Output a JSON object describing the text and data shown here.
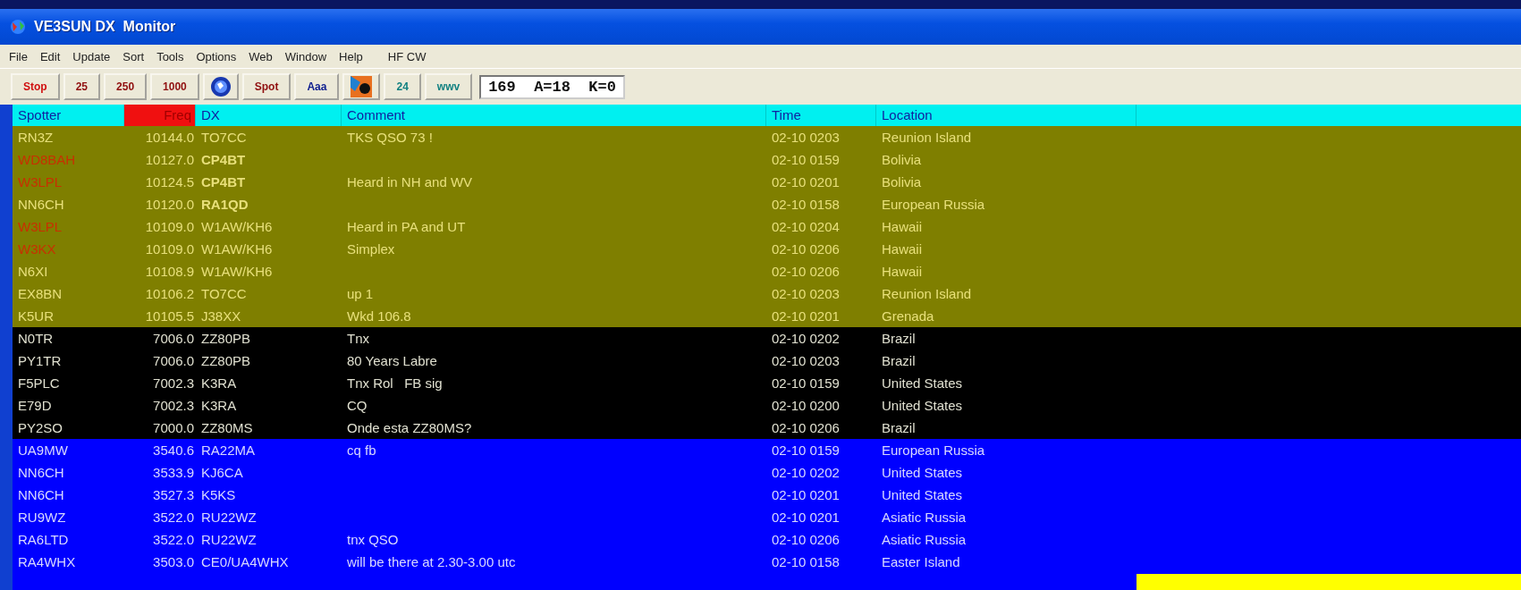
{
  "window": {
    "title": "VE3SUN DX  Monitor"
  },
  "menu": [
    "File",
    "Edit",
    "Update",
    "Sort",
    "Tools",
    "Options",
    "Web",
    "Window",
    "Help",
    "HF CW"
  ],
  "toolbar": [
    {
      "kind": "text",
      "label": "Stop",
      "color": "#d01010"
    },
    {
      "kind": "text",
      "label": "25",
      "color": "#901010"
    },
    {
      "kind": "text",
      "label": "250",
      "color": "#901010"
    },
    {
      "kind": "text",
      "label": "1000",
      "color": "#901010"
    },
    {
      "kind": "icon"
    },
    {
      "kind": "text",
      "label": "Spot",
      "color": "#901010"
    },
    {
      "kind": "text",
      "label": "Aaa",
      "color": "#102090"
    },
    {
      "kind": "icon"
    },
    {
      "kind": "text",
      "label": "24",
      "color": "#108080"
    },
    {
      "kind": "text",
      "label": "wwv",
      "color": "#108080"
    }
  ],
  "status_field": "169  A=18  K=0",
  "table": {
    "columns": [
      {
        "label": "Spotter",
        "selected": false
      },
      {
        "label": "Freq",
        "selected": true
      },
      {
        "label": "DX",
        "selected": false
      },
      {
        "label": "Comment",
        "selected": false
      },
      {
        "label": "Time",
        "selected": false
      },
      {
        "label": "Location",
        "selected": false
      }
    ],
    "groups": [
      {
        "color": "#7f7f00",
        "rows": [
          {
            "spotter": "RN3Z",
            "highlighted": false,
            "freq": "10144.0",
            "dx": "TO7CC",
            "dx_bold": false,
            "comment": "TKS QSO 73 !",
            "time": "02-10 0203",
            "location": "Reunion Island"
          },
          {
            "spotter": "WD8BAH",
            "highlighted": true,
            "freq": "10127.0",
            "dx": "CP4BT",
            "dx_bold": true,
            "comment": "",
            "time": "02-10 0159",
            "location": "Bolivia"
          },
          {
            "spotter": "W3LPL",
            "highlighted": true,
            "freq": "10124.5",
            "dx": "CP4BT",
            "dx_bold": true,
            "comment": "Heard in NH and WV",
            "time": "02-10 0201",
            "location": "Bolivia"
          },
          {
            "spotter": "NN6CH",
            "highlighted": false,
            "freq": "10120.0",
            "dx": "RA1QD",
            "dx_bold": true,
            "comment": "",
            "time": "02-10 0158",
            "location": "European Russia"
          },
          {
            "spotter": "W3LPL",
            "highlighted": true,
            "freq": "10109.0",
            "dx": "W1AW/KH6",
            "dx_bold": false,
            "comment": "Heard in PA and UT",
            "time": "02-10 0204",
            "location": "Hawaii"
          },
          {
            "spotter": "W3KX",
            "highlighted": true,
            "freq": "10109.0",
            "dx": "W1AW/KH6",
            "dx_bold": false,
            "comment": "Simplex",
            "time": "02-10 0206",
            "location": "Hawaii"
          },
          {
            "spotter": "N6XI",
            "highlighted": false,
            "freq": "10108.9",
            "dx": "W1AW/KH6",
            "dx_bold": false,
            "comment": "",
            "time": "02-10 0206",
            "location": "Hawaii"
          },
          {
            "spotter": "EX8BN",
            "highlighted": false,
            "freq": "10106.2",
            "dx": "TO7CC",
            "dx_bold": false,
            "comment": "up 1",
            "time": "02-10 0203",
            "location": "Reunion Island"
          },
          {
            "spotter": "K5UR",
            "highlighted": false,
            "freq": "10105.5",
            "dx": "J38XX",
            "dx_bold": false,
            "comment": "Wkd 106.8",
            "time": "02-10 0201",
            "location": "Grenada"
          }
        ]
      },
      {
        "color": "#000000",
        "rows": [
          {
            "spotter": "N0TR",
            "highlighted": false,
            "freq": "7006.0",
            "dx": "ZZ80PB",
            "dx_bold": false,
            "comment": "Tnx",
            "time": "02-10 0202",
            "location": "Brazil"
          },
          {
            "spotter": "PY1TR",
            "highlighted": false,
            "freq": "7006.0",
            "dx": "ZZ80PB",
            "dx_bold": false,
            "comment": "80 Years Labre",
            "time": "02-10 0203",
            "location": "Brazil"
          },
          {
            "spotter": "F5PLC",
            "highlighted": false,
            "freq": "7002.3",
            "dx": "K3RA",
            "dx_bold": false,
            "comment": "Tnx Rol   FB sig",
            "time": "02-10 0159",
            "location": "United States"
          },
          {
            "spotter": "E79D",
            "highlighted": false,
            "freq": "7002.3",
            "dx": "K3RA",
            "dx_bold": false,
            "comment": "CQ",
            "time": "02-10 0200",
            "location": "United States"
          },
          {
            "spotter": "PY2SO",
            "highlighted": false,
            "freq": "7000.0",
            "dx": "ZZ80MS",
            "dx_bold": false,
            "comment": "Onde esta ZZ80MS?",
            "time": "02-10 0206",
            "location": "Brazil"
          }
        ]
      },
      {
        "color": "#0000ff",
        "rows": [
          {
            "spotter": "UA9MW",
            "highlighted": false,
            "freq": "3540.6",
            "dx": "RA22MA",
            "dx_bold": false,
            "comment": "cq fb",
            "time": "02-10 0159",
            "location": "European Russia"
          },
          {
            "spotter": "NN6CH",
            "highlighted": false,
            "freq": "3533.9",
            "dx": "KJ6CA",
            "dx_bold": false,
            "comment": "",
            "time": "02-10 0202",
            "location": "United States"
          },
          {
            "spotter": "NN6CH",
            "highlighted": false,
            "freq": "3527.3",
            "dx": "K5KS",
            "dx_bold": false,
            "comment": "",
            "time": "02-10 0201",
            "location": "United States"
          },
          {
            "spotter": "RU9WZ",
            "highlighted": false,
            "freq": "3522.0",
            "dx": "RU22WZ",
            "dx_bold": false,
            "comment": "",
            "time": "02-10 0201",
            "location": "Asiatic Russia"
          },
          {
            "spotter": "RA6LTD",
            "highlighted": false,
            "freq": "3522.0",
            "dx": "RU22WZ",
            "dx_bold": false,
            "comment": "tnx QSO",
            "time": "02-10 0206",
            "location": "Asiatic Russia"
          },
          {
            "spotter": "RA4WHX",
            "highlighted": false,
            "freq": "3503.0",
            "dx": "CE0/UA4WHX",
            "dx_bold": false,
            "comment": "will be there at 2.30-3.00 utc",
            "time": "02-10 0158",
            "location": "Easter Island"
          }
        ]
      }
    ]
  }
}
